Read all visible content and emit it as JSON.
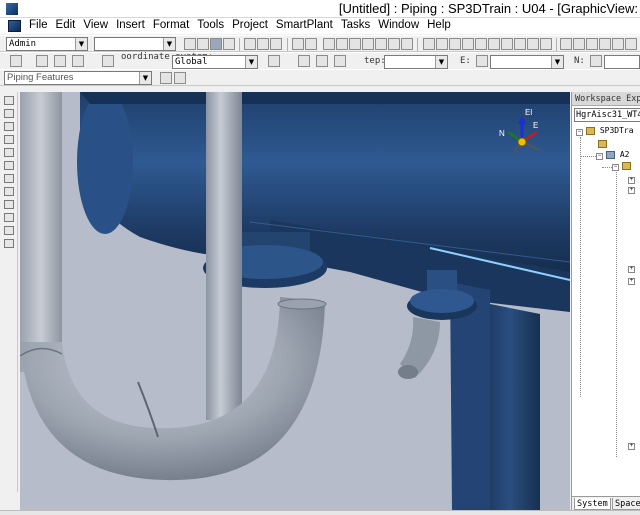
{
  "window": {
    "title": "[Untitled] : Piping : SP3DTrain : U04 - [GraphicView:"
  },
  "menu": {
    "items": [
      "File",
      "Edit",
      "View",
      "Insert",
      "Format",
      "Tools",
      "Project",
      "SmartPlant",
      "Tasks",
      "Window",
      "Help"
    ]
  },
  "toolbar1": {
    "permission_group": "Admin",
    "empty_combo": ""
  },
  "toolbar2": {
    "coord_label": "oordinate system:",
    "coord_value": "Global",
    "step_label": "tep:",
    "step_value": "",
    "e_label": "E:",
    "e_value": "",
    "n_label": "N:",
    "n_value": ""
  },
  "toolbar3": {
    "locate_filter": "Piping Features"
  },
  "viewport": {
    "background": "#b7bccb",
    "pipe_color": "#a5adb9",
    "vessel_color": "#274b7c",
    "compass": {
      "up_label": "El",
      "east_label": "E",
      "north_label": "N"
    }
  },
  "workspace": {
    "header": "Workspace Exp",
    "filter": "HgrAisc31_WT4",
    "tree": [
      {
        "label": "SP3DTra"
      },
      {
        "label": ""
      },
      {
        "label": "A2"
      },
      {
        "label": ""
      }
    ],
    "tabs": [
      "System",
      "Space"
    ]
  }
}
